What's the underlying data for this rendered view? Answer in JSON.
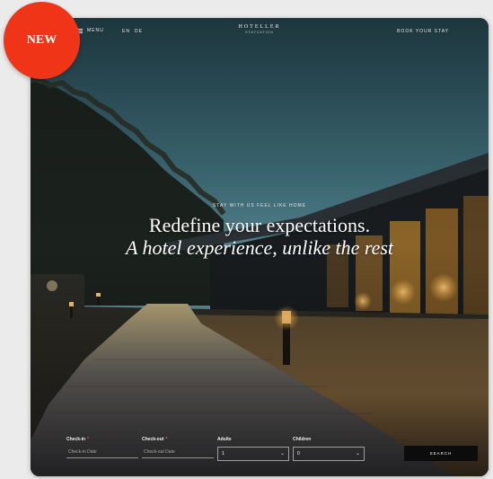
{
  "badge": {
    "label": "NEW"
  },
  "header": {
    "menu_label": "MENU",
    "languages": [
      "EN",
      "DE"
    ],
    "brand_name": "HOTELLER",
    "brand_sub": "staycation",
    "book_label": "BOOK YOUR STAY"
  },
  "hero": {
    "eyebrow": "STAY WITH US FEEL LIKE HOME",
    "headline": "Redefine your expectations.",
    "subline": "A hotel experience, unlike the rest"
  },
  "booking": {
    "checkin": {
      "label": "Check-in",
      "required": "*",
      "placeholder": "Check-in Date"
    },
    "checkout": {
      "label": "Check-out",
      "required": "*",
      "placeholder": "Check-out Date"
    },
    "adults": {
      "label": "Adults",
      "value": "1"
    },
    "children": {
      "label": "Children",
      "value": "0"
    },
    "search_label": "SEARCH"
  },
  "colors": {
    "badge": "#f03418",
    "search_button": "#0c0c0c",
    "sky_top": "#254650",
    "sky_bottom": "#5c8c98"
  },
  "icons": {
    "menu": "hamburger-icon",
    "select": "chevron-down-icon"
  }
}
